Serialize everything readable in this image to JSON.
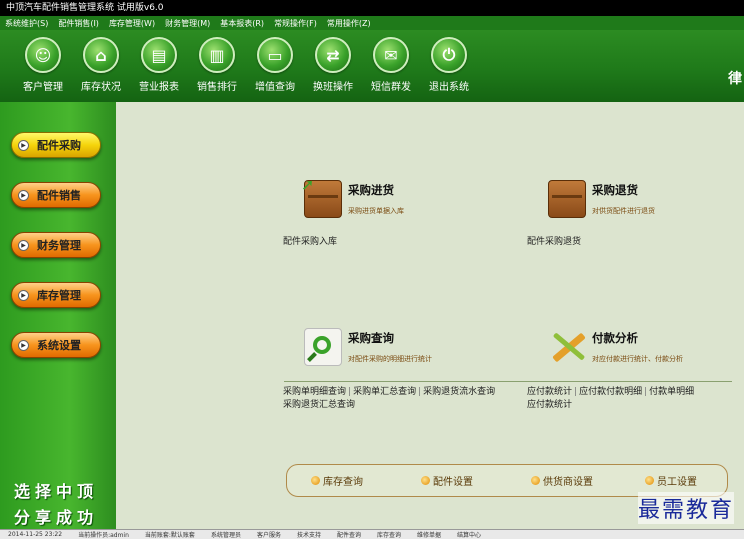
{
  "window": {
    "title": "中顶汽车配件销售管理系统 试用版v6.0"
  },
  "menu": [
    "系统维护(S)",
    "配件销售(I)",
    "库存管理(W)",
    "财务管理(M)",
    "基本报表(R)",
    "常规操作(F)",
    "常用操作(Z)"
  ],
  "toolbar": [
    {
      "label": "客户管理",
      "icon": "customer-icon"
    },
    {
      "label": "库存状况",
      "icon": "home-icon"
    },
    {
      "label": "营业报表",
      "icon": "report-icon"
    },
    {
      "label": "销售排行",
      "icon": "bar-chart-icon"
    },
    {
      "label": "增值查询",
      "icon": "chat-icon"
    },
    {
      "label": "换班操作",
      "icon": "swap-icon"
    },
    {
      "label": "短信群发",
      "icon": "message-icon"
    },
    {
      "label": "退出系统",
      "icon": "power-icon"
    }
  ],
  "toolbar_edge": "律",
  "sidebar": {
    "buttons": [
      {
        "label": "配件采购",
        "active": true
      },
      {
        "label": "配件销售",
        "active": false
      },
      {
        "label": "财务管理",
        "active": false
      },
      {
        "label": "库存管理",
        "active": false
      },
      {
        "label": "系统设置",
        "active": false
      }
    ],
    "slogan_line1": "选择中顶",
    "slogan_line2": "分享成功"
  },
  "main": {
    "purchase_in": {
      "title": "采购进货",
      "sub": "采购进货单据入库",
      "link": "配件采购入库"
    },
    "purchase_return": {
      "title": "采购退货",
      "sub": "对供货配件进行退货",
      "link": "配件采购退货"
    },
    "purchase_query": {
      "title": "采购查询",
      "sub": "对配件采购的明细进行统计",
      "links_row1": [
        "采购单明细查询",
        "采购单汇总查询",
        "采购退货流水查询"
      ],
      "links_row2": [
        "采购退货汇总查询"
      ]
    },
    "payment": {
      "title": "付款分析",
      "sub": "对应付款进行统计、付款分析",
      "links_row1": [
        "应付款统计",
        "应付款付款明细",
        "付款单明细"
      ],
      "links_row2": [
        "应付款统计"
      ]
    },
    "quick": [
      "库存查询",
      "配件设置",
      "供货商设置",
      "员工设置"
    ]
  },
  "watermark": "最需教育",
  "status": [
    "2014-11-25 23:22",
    "当前操作员:admin",
    "当前账套:默认账套",
    "系统管理员",
    "客户服务",
    "技术支持",
    "配件查询",
    "库存查询",
    "维修单据",
    "结算中心"
  ]
}
